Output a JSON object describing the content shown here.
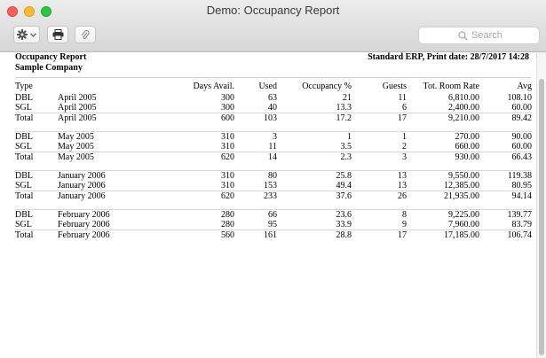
{
  "window": {
    "title": "Demo: Occupancy Report"
  },
  "toolbar": {
    "gear_icon": "gear-icon",
    "print_icon": "printer-icon",
    "attach_icon": "paperclip-icon",
    "search_placeholder": "Search"
  },
  "report": {
    "title": "Occupancy Report",
    "company": "Sample Company",
    "print_info": "Standard ERP, Print date: 28/7/2017 14:28",
    "columns": [
      "Type",
      "",
      "Days Avail.",
      "Used",
      "Occupancy %",
      "Guests",
      "Tot. Room Rate",
      "Avg"
    ],
    "groups": [
      {
        "rows": [
          [
            "DBL",
            "April 2005",
            "300",
            "63",
            "21",
            "11",
            "6,810.00",
            "108.10"
          ],
          [
            "SGL",
            "April 2005",
            "300",
            "40",
            "13.3",
            "6",
            "2,400.00",
            "60.00"
          ],
          [
            "Total",
            "April 2005",
            "600",
            "103",
            "17.2",
            "17",
            "9,210.00",
            "89.42"
          ]
        ]
      },
      {
        "rows": [
          [
            "DBL",
            "May 2005",
            "310",
            "3",
            "1",
            "1",
            "270.00",
            "90.00"
          ],
          [
            "SGL",
            "May 2005",
            "310",
            "11",
            "3.5",
            "2",
            "660.00",
            "60.00"
          ],
          [
            "Total",
            "May 2005",
            "620",
            "14",
            "2.3",
            "3",
            "930.00",
            "66.43"
          ]
        ]
      },
      {
        "rows": [
          [
            "DBL",
            "January 2006",
            "310",
            "80",
            "25.8",
            "13",
            "9,550.00",
            "119.38"
          ],
          [
            "SGL",
            "January 2006",
            "310",
            "153",
            "49.4",
            "13",
            "12,385.00",
            "80.95"
          ],
          [
            "Total",
            "January 2006",
            "620",
            "233",
            "37.6",
            "26",
            "21,935.00",
            "94.14"
          ]
        ]
      },
      {
        "rows": [
          [
            "DBL",
            "February 2006",
            "280",
            "66",
            "23.6",
            "8",
            "9,225.00",
            "139.77"
          ],
          [
            "SGL",
            "February 2006",
            "280",
            "95",
            "33.9",
            "9",
            "7,960.00",
            "83.79"
          ],
          [
            "Total",
            "February 2006",
            "560",
            "161",
            "28.8",
            "17",
            "17,185.00",
            "106.74"
          ]
        ]
      }
    ]
  }
}
